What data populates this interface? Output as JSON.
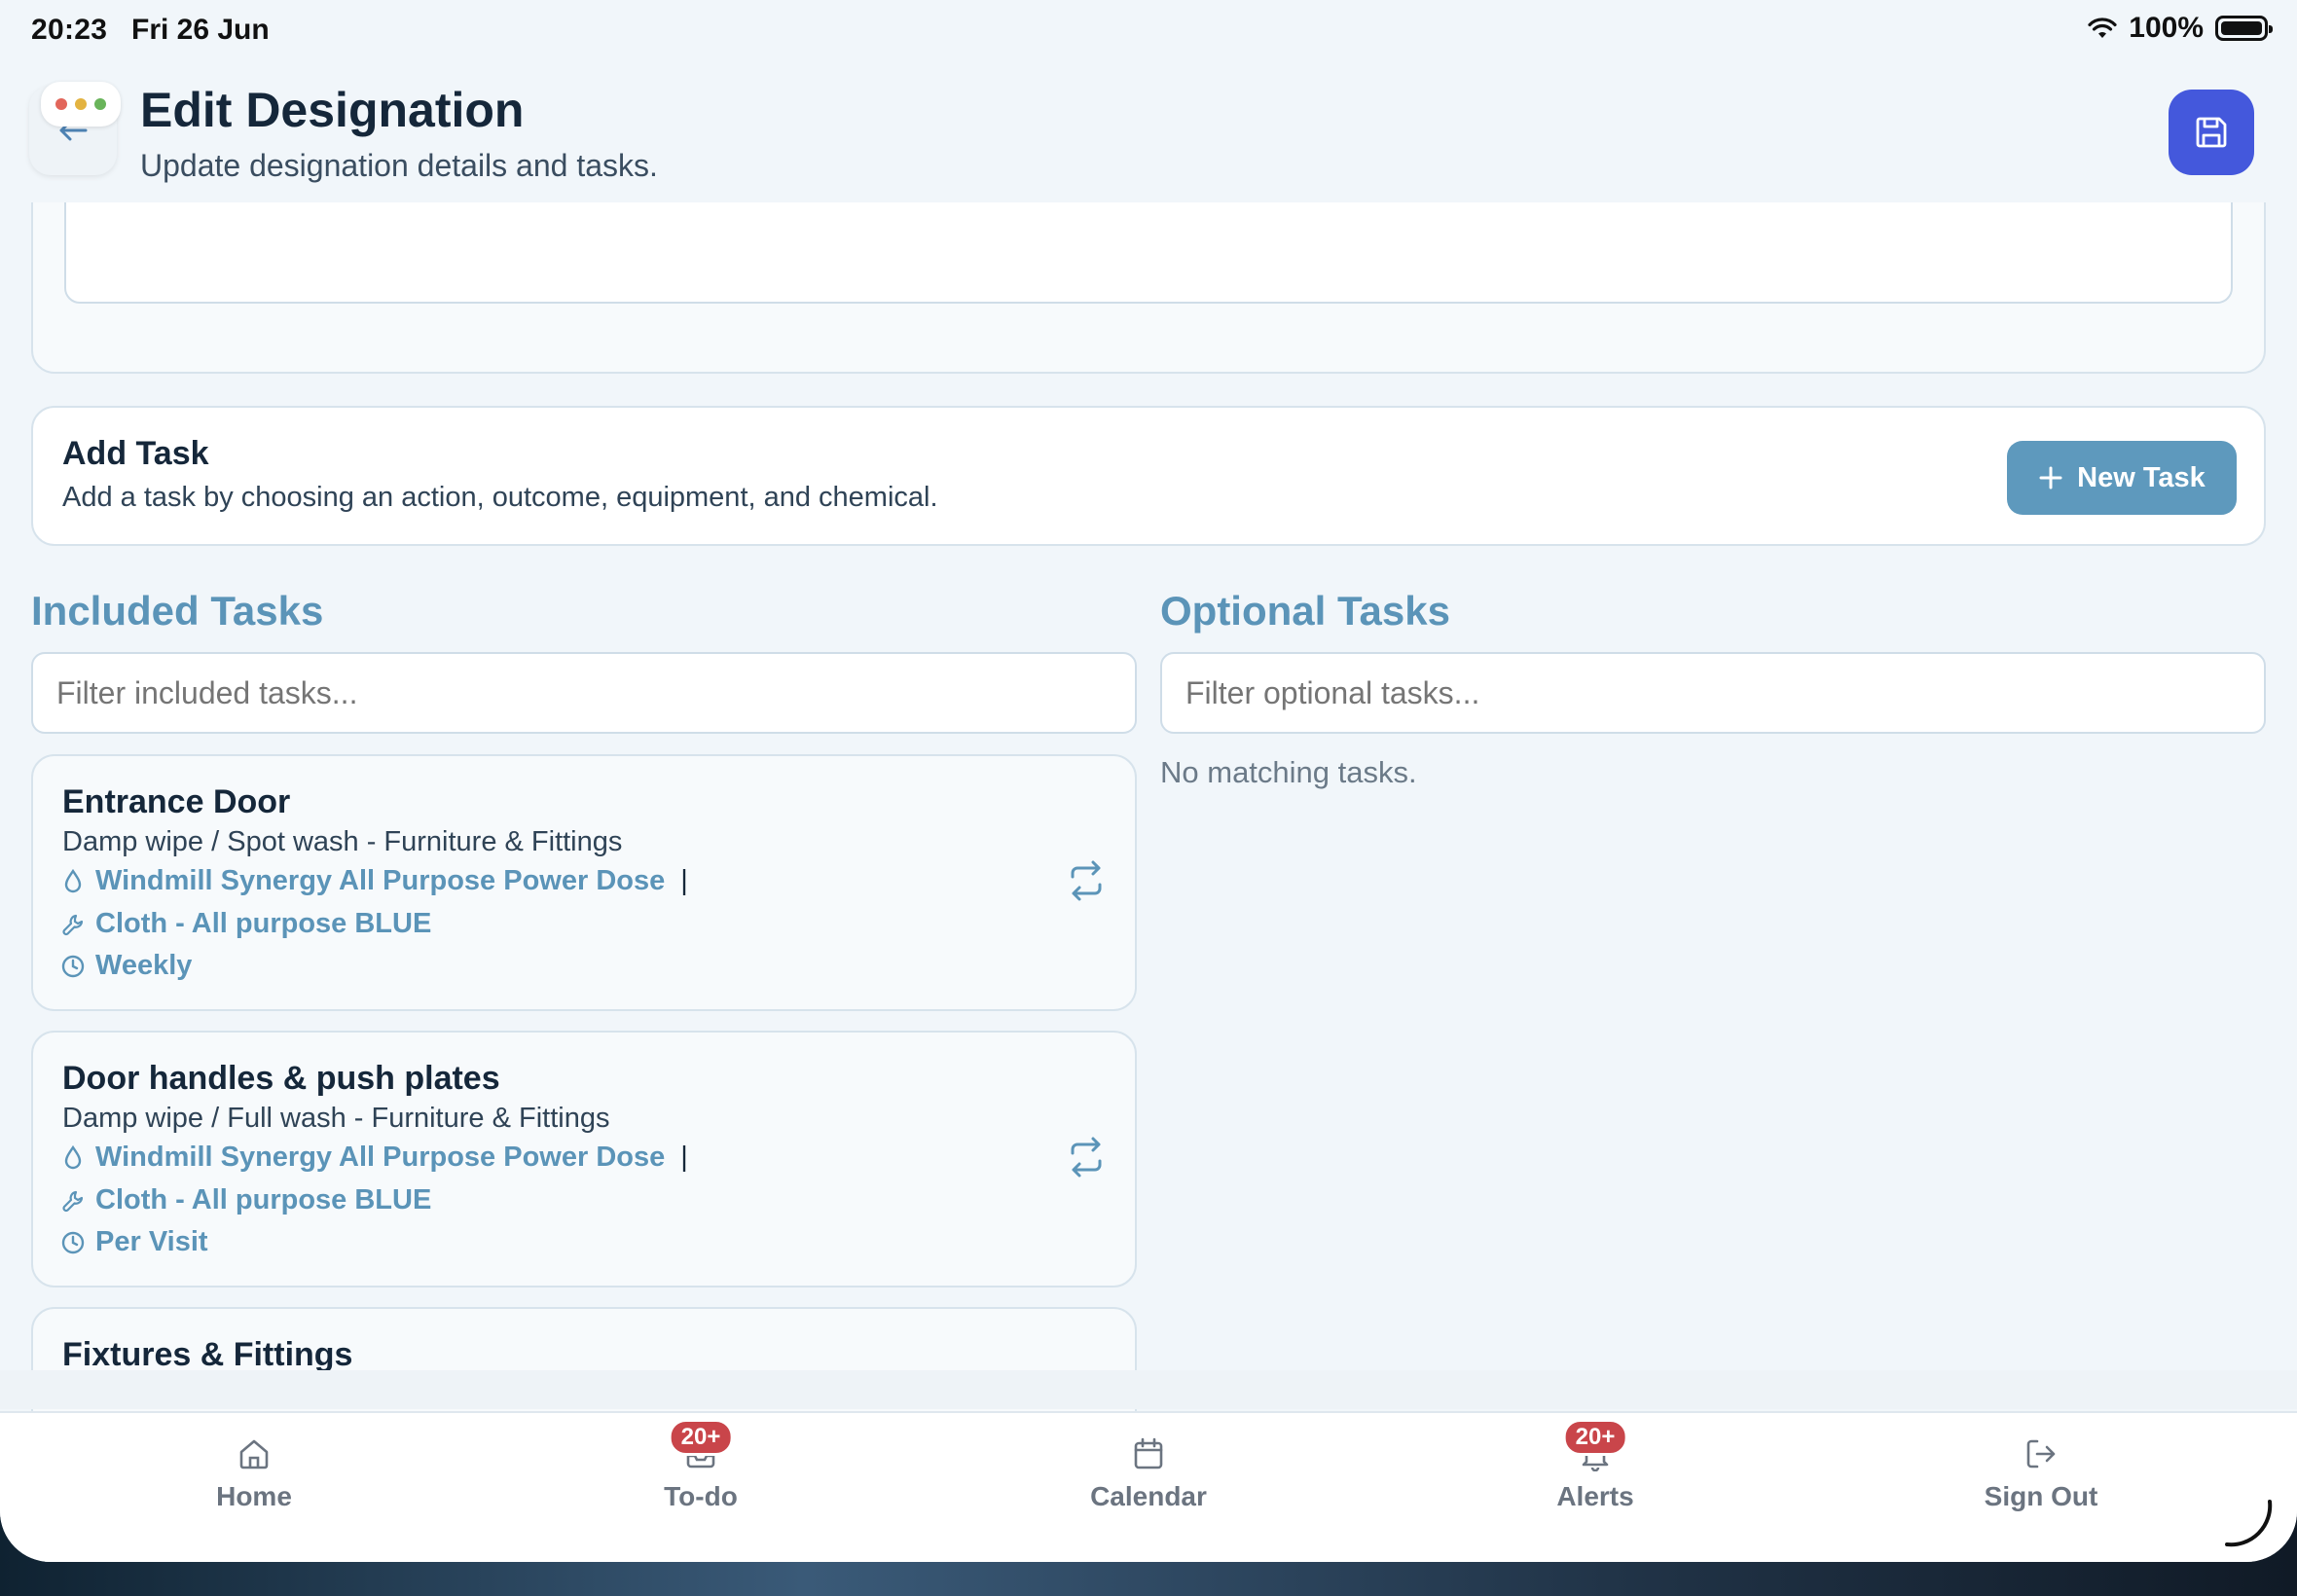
{
  "status_bar": {
    "time": "20:23",
    "date": "Fri 26 Jun",
    "battery": "100%"
  },
  "header": {
    "title": "Edit Designation",
    "subtitle": "Update designation details and tasks."
  },
  "add_task": {
    "title": "Add Task",
    "description": "Add a task by choosing an action, outcome, equipment, and chemical.",
    "button_label": "New Task"
  },
  "included": {
    "title": "Included Tasks",
    "filter_placeholder": "Filter included tasks...",
    "tasks": [
      {
        "name": "Entrance Door",
        "description": "Damp wipe / Spot wash - Furniture & Fittings",
        "chemical": "Windmill Synergy All Purpose Power Dose",
        "separator": "|",
        "equipment": "Cloth - All purpose BLUE",
        "frequency": "Weekly"
      },
      {
        "name": "Door handles & push plates",
        "description": "Damp wipe / Full wash - Furniture & Fittings",
        "chemical": "Windmill Synergy All Purpose Power Dose",
        "separator": "|",
        "equipment": "Cloth - All purpose BLUE",
        "frequency": "Per Visit"
      },
      {
        "name": "Fixtures & Fittings"
      }
    ]
  },
  "optional": {
    "title": "Optional Tasks",
    "filter_placeholder": "Filter optional tasks...",
    "empty_text": "No matching tasks."
  },
  "tabbar": {
    "items": [
      {
        "label": "Home",
        "icon": "home-icon",
        "badge": ""
      },
      {
        "label": "To-do",
        "icon": "inbox-icon",
        "badge": "20+"
      },
      {
        "label": "Calendar",
        "icon": "calendar-icon",
        "badge": ""
      },
      {
        "label": "Alerts",
        "icon": "bell-icon",
        "badge": "20+"
      },
      {
        "label": "Sign Out",
        "icon": "sign-out-icon",
        "badge": ""
      }
    ]
  },
  "colors": {
    "accent": "#5b94b8",
    "save_button": "#4458dc",
    "badge": "#c9454a",
    "title_text": "#15273a"
  }
}
